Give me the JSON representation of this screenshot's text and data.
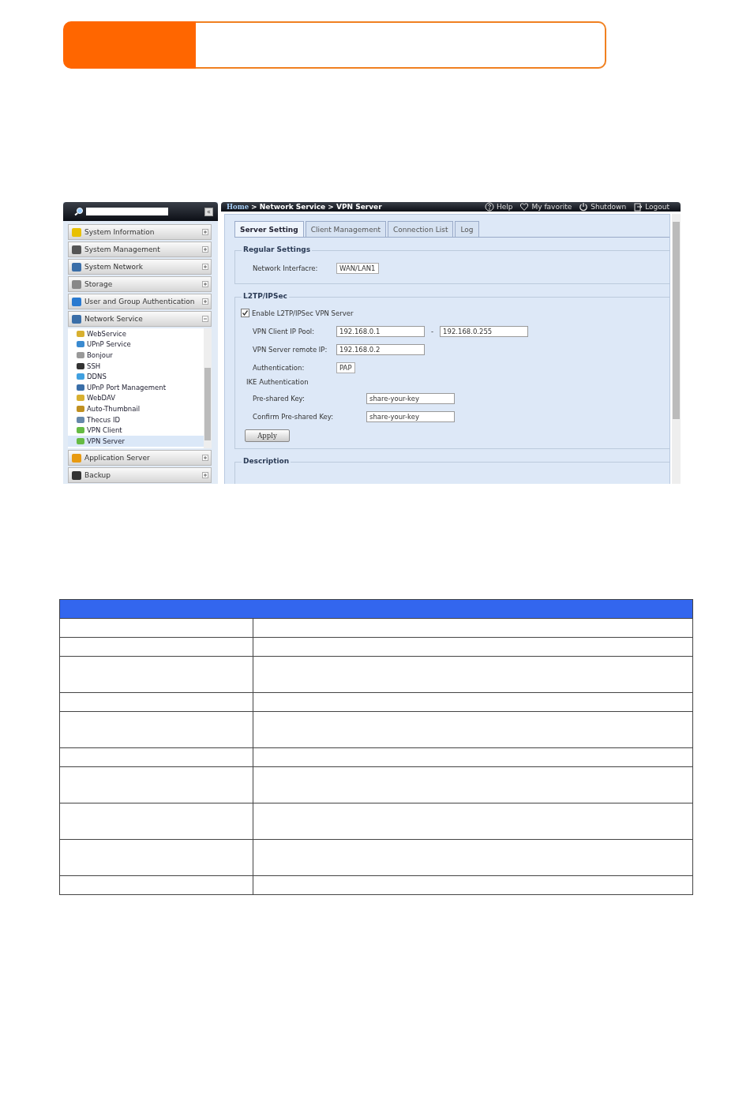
{
  "sidebar": {
    "collapse_button": "«",
    "sections": [
      {
        "label": "System Information",
        "expanded": false
      },
      {
        "label": "System Management",
        "expanded": false
      },
      {
        "label": "System Network",
        "expanded": false
      },
      {
        "label": "Storage",
        "expanded": false
      },
      {
        "label": "User and Group Authentication",
        "expanded": false
      },
      {
        "label": "Network Service",
        "expanded": true,
        "children": [
          {
            "label": "WebService",
            "selected": false
          },
          {
            "label": "UPnP Service",
            "selected": false
          },
          {
            "label": "Bonjour",
            "selected": false
          },
          {
            "label": "SSH",
            "selected": false
          },
          {
            "label": "DDNS",
            "selected": false
          },
          {
            "label": "UPnP Port Management",
            "selected": false
          },
          {
            "label": "WebDAV",
            "selected": false
          },
          {
            "label": "Auto-Thumbnail",
            "selected": false
          },
          {
            "label": "Thecus ID",
            "selected": false
          },
          {
            "label": "VPN Client",
            "selected": false
          },
          {
            "label": "VPN Server",
            "selected": true
          }
        ]
      },
      {
        "label": "Application Server",
        "expanded": false
      },
      {
        "label": "Backup",
        "expanded": false
      }
    ]
  },
  "breadcrumb": {
    "home": "Home",
    "path": "> Network Service > VPN Server"
  },
  "toolbar": [
    "Help",
    "My favorite",
    "Shutdown",
    "Logout"
  ],
  "tabs": [
    {
      "label": "Server Setting",
      "selected": true
    },
    {
      "label": "Client Management",
      "selected": false
    },
    {
      "label": "Connection List",
      "selected": false
    },
    {
      "label": "Log",
      "selected": false
    }
  ],
  "regular_settings": {
    "title": "Regular Settings",
    "label": "Network Interfacre:",
    "value": "WAN/LAN1"
  },
  "l2tp": {
    "title": "L2TP/IPSec",
    "enable_label": "Enable L2TP/IPSec VPN Server",
    "checked": true,
    "pool_label": "VPN Client IP Pool:",
    "pool_start": "192.168.0.1",
    "pool_sep": "-",
    "pool_end": "192.168.0.255",
    "remote_label": "VPN Server remote IP:",
    "remote_value": "192.168.0.2",
    "auth_label": "Authentication:",
    "auth_value": "PAP",
    "ike_title": "IKE Authentication",
    "psk_label": "Pre-shared Key:",
    "psk_value": "share-your-key",
    "confirm_label": "Confirm Pre-shared Key:",
    "confirm_value": "share-your-key",
    "apply": "Apply"
  },
  "description": {
    "title": "Description"
  }
}
